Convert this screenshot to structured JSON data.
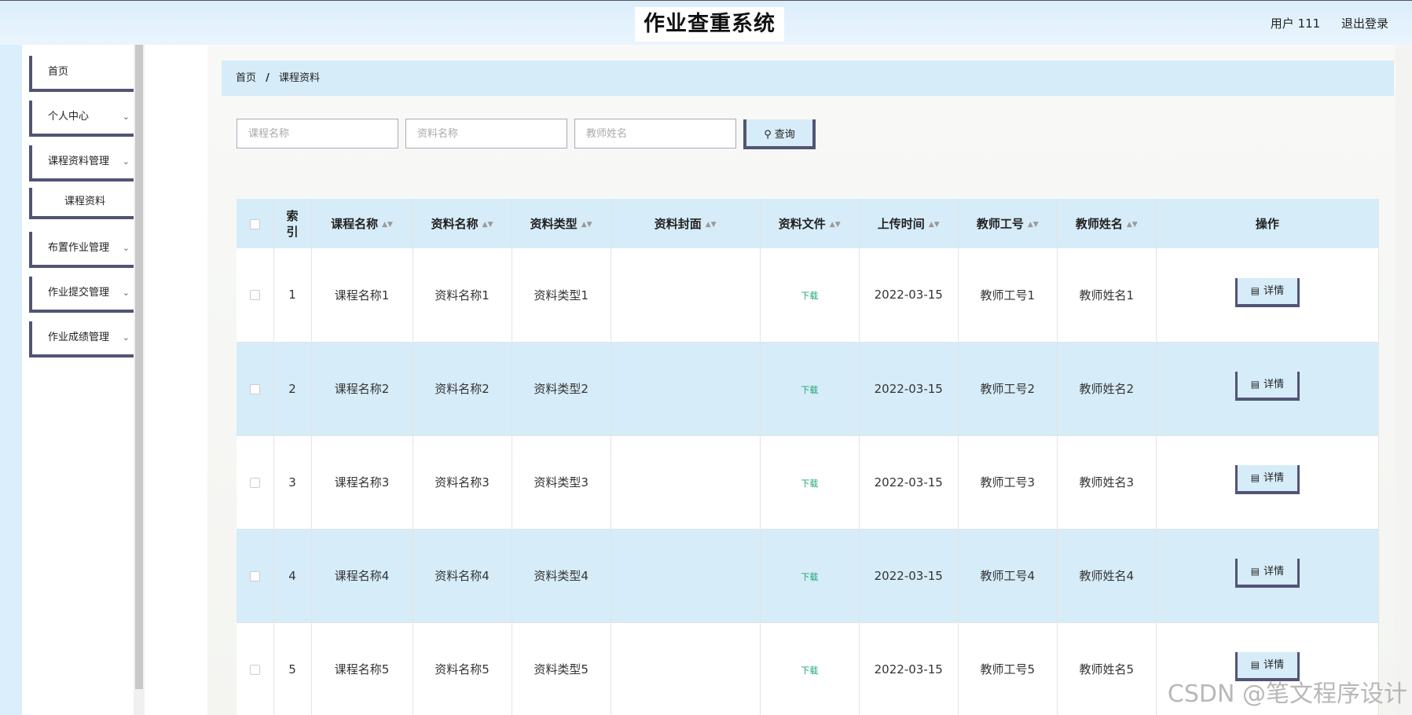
{
  "header": {
    "title": "作业查重系统",
    "user_label": "用户 111",
    "logout_label": "退出登录"
  },
  "sidebar": {
    "items": [
      {
        "label": "首页",
        "has_children": false
      },
      {
        "label": "个人中心",
        "has_children": true
      },
      {
        "label": "课程资料管理",
        "has_children": true
      },
      {
        "label": "布置作业管理",
        "has_children": true
      },
      {
        "label": "作业提交管理",
        "has_children": true
      },
      {
        "label": "作业成绩管理",
        "has_children": true
      }
    ],
    "submenu_active": "课程资料"
  },
  "breadcrumb": {
    "home": "首页",
    "separator": "/",
    "current": "课程资料"
  },
  "search": {
    "course_placeholder": "课程名称",
    "material_placeholder": "资料名称",
    "teacher_placeholder": "教师姓名",
    "button_label": "查询"
  },
  "table": {
    "headers": {
      "index": "索引",
      "course_name": "课程名称",
      "material_name": "资料名称",
      "material_type": "资料类型",
      "material_cover": "资料封面",
      "material_file": "资料文件",
      "upload_time": "上传时间",
      "teacher_id": "教师工号",
      "teacher_name": "教师姓名",
      "actions": "操作"
    },
    "rows": [
      {
        "index": "1",
        "course_name": "课程名称1",
        "material_name": "资料名称1",
        "material_type": "资料类型1",
        "file_link": "下载",
        "upload_time": "2022-03-15",
        "teacher_id": "教师工号1",
        "teacher_name": "教师姓名1",
        "detail_label": "详情"
      },
      {
        "index": "2",
        "course_name": "课程名称2",
        "material_name": "资料名称2",
        "material_type": "资料类型2",
        "file_link": "下载",
        "upload_time": "2022-03-15",
        "teacher_id": "教师工号2",
        "teacher_name": "教师姓名2",
        "detail_label": "详情"
      },
      {
        "index": "3",
        "course_name": "课程名称3",
        "material_name": "资料名称3",
        "material_type": "资料类型3",
        "file_link": "下载",
        "upload_time": "2022-03-15",
        "teacher_id": "教师工号3",
        "teacher_name": "教师姓名3",
        "detail_label": "详情"
      },
      {
        "index": "4",
        "course_name": "课程名称4",
        "material_name": "资料名称4",
        "material_type": "资料类型4",
        "file_link": "下载",
        "upload_time": "2022-03-15",
        "teacher_id": "教师工号4",
        "teacher_name": "教师姓名4",
        "detail_label": "详情"
      },
      {
        "index": "5",
        "course_name": "课程名称5",
        "material_name": "资料名称5",
        "material_type": "资料类型5",
        "file_link": "下载",
        "upload_time": "2022-03-15",
        "teacher_id": "教师工号5",
        "teacher_name": "教师姓名5",
        "detail_label": "详情"
      }
    ]
  },
  "watermark": "CSDN @笔文程序设计",
  "colors": {
    "accent_light_blue": "#d6ecf8",
    "border_dark": "#525475",
    "download_green": "#1aa774"
  }
}
